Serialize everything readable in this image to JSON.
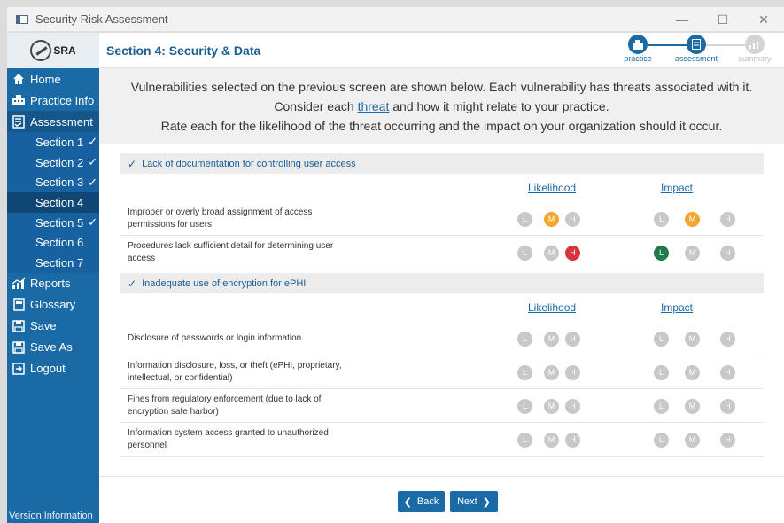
{
  "window": {
    "title": "Security Risk Assessment",
    "minimize": "—",
    "maximize": "☐",
    "close": "✕"
  },
  "logo": {
    "text": "SRA"
  },
  "sidebar": {
    "items": [
      {
        "label": "Home",
        "icon": "home-icon"
      },
      {
        "label": "Practice Info",
        "icon": "building-icon"
      },
      {
        "label": "Assessment",
        "icon": "checklist-icon"
      }
    ],
    "sections": [
      {
        "label": "Section 1",
        "completed": "✓"
      },
      {
        "label": "Section 2",
        "completed": "✓"
      },
      {
        "label": "Section 3",
        "completed": "✓"
      },
      {
        "label": "Section 4",
        "completed": ""
      },
      {
        "label": "Section 5",
        "completed": "✓"
      },
      {
        "label": "Section 6",
        "completed": ""
      },
      {
        "label": "Section 7",
        "completed": ""
      }
    ],
    "bottom_items": [
      {
        "label": "Reports",
        "icon": "chart-icon"
      },
      {
        "label": "Glossary",
        "icon": "book-icon"
      },
      {
        "label": "Save",
        "icon": "save-icon"
      },
      {
        "label": "Save As",
        "icon": "save-as-icon"
      },
      {
        "label": "Logout",
        "icon": "logout-icon"
      }
    ],
    "version": "Version Information"
  },
  "header": {
    "title": "Section 4: Security & Data",
    "steps": [
      {
        "label": "practice"
      },
      {
        "label": "assessment"
      },
      {
        "label": "summary"
      }
    ]
  },
  "intro": {
    "line1": "Vulnerabilities selected on the previous screen are shown below. Each vulnerability has threats associated with it.",
    "line2_pre": "Consider each",
    "line2_link": "threat",
    "line2_post": "and how it might relate to your practice.",
    "line3": "Rate each for the likelihood of the threat occurring and the impact on your organization should it occur."
  },
  "labels": {
    "likelihood": "Likelihood",
    "impact": "Impact",
    "low": "L",
    "medium": "M",
    "high": "H"
  },
  "vulnerabilities": [
    {
      "title": "Lack of documentation for controlling user access",
      "threats": [
        {
          "line1": "Improper or overly broad assignment of access",
          "line2": "permissions for users",
          "likelihood": "M",
          "impact": "M"
        },
        {
          "line1": "Procedures lack sufficient detail for determining user",
          "line2": "access",
          "likelihood": "H",
          "impact": "L"
        }
      ]
    },
    {
      "title": "Inadequate use of encryption for ePHI",
      "threats": [
        {
          "line1": "Disclosure of passwords or login information",
          "line2": "",
          "likelihood": "",
          "impact": ""
        },
        {
          "line1": "Information disclosure, loss, or theft (ePHI, proprietary,",
          "line2": "intellectual, or confidential)",
          "likelihood": "",
          "impact": ""
        },
        {
          "line1": "Fines from regulatory enforcement (due to lack of",
          "line2": "encryption safe harbor)",
          "likelihood": "",
          "impact": ""
        },
        {
          "line1": "Information system access granted to unauthorized",
          "line2": "personnel",
          "likelihood": "",
          "impact": ""
        }
      ]
    }
  ],
  "footer": {
    "back": "Back",
    "next": "Next"
  },
  "colors": {
    "primary": "#1a6aa6",
    "medium": "#f2a62c",
    "high": "#d7343b",
    "low": "#1f7a4c",
    "unselected": "#c8c8c8"
  }
}
